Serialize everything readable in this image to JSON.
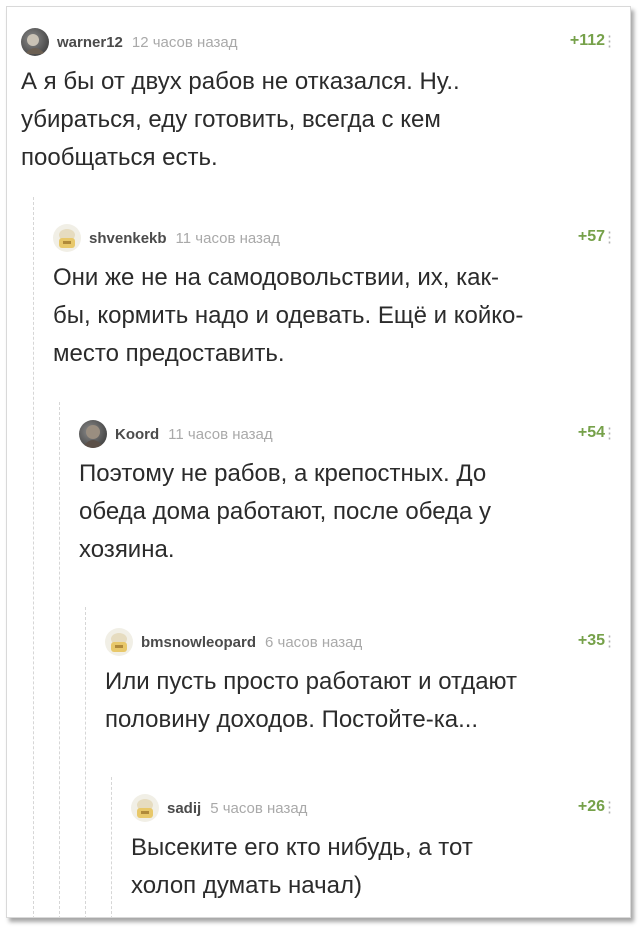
{
  "comments": [
    {
      "user": "warner12",
      "time": "12 часов назад",
      "rating": "+112",
      "more": "⋮",
      "avatar": "photo-avatar",
      "lines": [
        "А я бы от двух рабов не отказался. Ну..",
        "убираться, еду готовить, всегда с кем",
        "пообщаться есть."
      ]
    },
    {
      "user": "shvenkekb",
      "time": "11 часов назад",
      "rating": "+57",
      "more": "⋮",
      "avatar": "default-avatar",
      "lines": [
        "Они же не на самодовольствии, их, как-",
        "бы, кормить надо и одевать. Ещё и койко-",
        "место предоставить."
      ]
    },
    {
      "user": "Koord",
      "time": "11 часов назад",
      "rating": "+54",
      "more": "⋮",
      "avatar": "photo-avatar",
      "lines": [
        "Поэтому не рабов, а крепостных. До",
        "обеда дома работают, после обеда у",
        "хозяина."
      ]
    },
    {
      "user": "bmsnowleopard",
      "time": "6 часов назад",
      "rating": "+35",
      "more": "⋮",
      "avatar": "default-avatar",
      "lines": [
        "Или пусть просто работают и отдают",
        "половину доходов. Постойте-ка..."
      ]
    },
    {
      "user": "sadij",
      "time": "5 часов назад",
      "rating": "+26",
      "more": "⋮",
      "avatar": "default-avatar",
      "lines": [
        "Высеките его кто нибудь, а тот",
        "холоп думать начал)"
      ]
    }
  ],
  "colors": {
    "rating": "#76a14a",
    "time": "#a9a9a9",
    "user": "#4b4b4b",
    "text": "#2b2b2b"
  }
}
